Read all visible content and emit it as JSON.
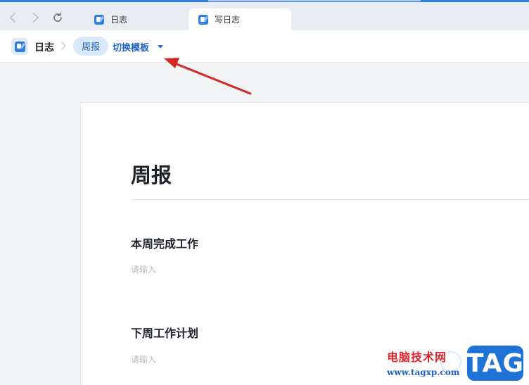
{
  "tabs": [
    {
      "label": "日志",
      "active": false
    },
    {
      "label": "写日志",
      "active": true
    }
  ],
  "header": {
    "title": "日志",
    "current_template": "周报",
    "switch_template_label": "切换模板"
  },
  "doc": {
    "title": "周报",
    "sections": [
      {
        "title": "本周完成工作",
        "placeholder": "请输入"
      },
      {
        "title": "下周工作计划",
        "placeholder": "请输入"
      }
    ]
  },
  "watermark": {
    "text": "电脑技术网",
    "url": "www.tagxp.com",
    "badge": "TAG"
  },
  "colors": {
    "accent": "#2f7de1",
    "pill_bg": "#d9e8fb",
    "arrow": "#d02a22"
  }
}
